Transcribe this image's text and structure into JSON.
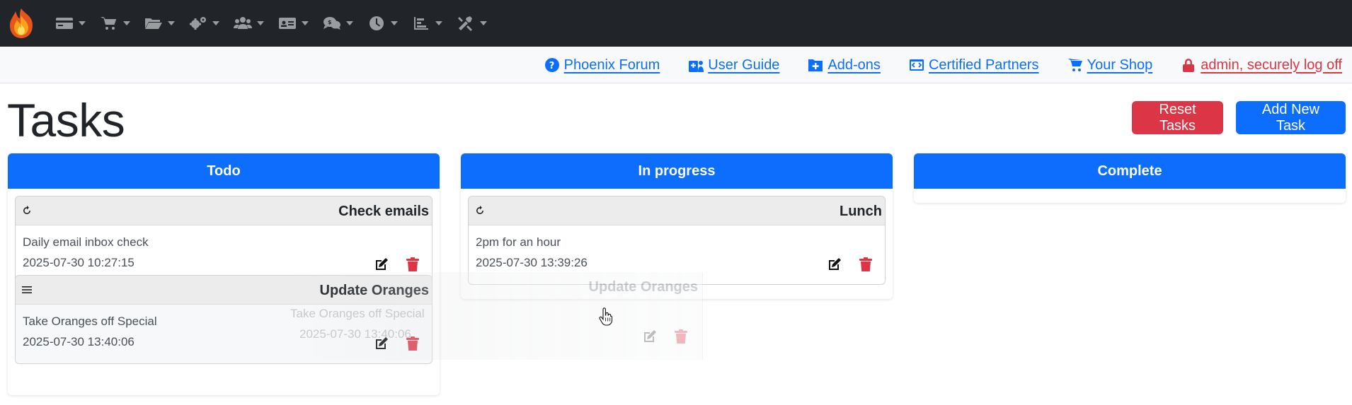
{
  "nav": {
    "icons": [
      "credit-card-icon",
      "shopping-cart-icon",
      "folder-open-icon",
      "gears-icon",
      "users-icon",
      "id-card-icon",
      "comments-dollar-icon",
      "clock-icon",
      "bar-chart-icon",
      "tools-icon"
    ]
  },
  "links": {
    "forum": "Phoenix Forum",
    "guide": "User Guide",
    "addons": "Add-ons",
    "partners": "Certified Partners",
    "shop": "Your Shop",
    "logoff": "admin, securely log off"
  },
  "page": {
    "title": "Tasks",
    "reset_label": "Reset Tasks",
    "add_label": "Add New Task"
  },
  "columns": {
    "todo": {
      "title": "Todo",
      "tasks": [
        {
          "title": "Check emails",
          "description": "Daily email inbox check",
          "date": "2025-07-30 10:27:15",
          "icon": "recurring-icon"
        },
        {
          "title": "Update Oranges",
          "description": "Take Oranges off Special",
          "date": "2025-07-30 13:40:06",
          "icon": "drag-handle-icon"
        }
      ]
    },
    "progress": {
      "title": "In progress",
      "tasks": [
        {
          "title": "Lunch",
          "description": "2pm for an hour",
          "date": "2025-07-30 13:39:26",
          "icon": "recurring-icon"
        }
      ]
    },
    "complete": {
      "title": "Complete",
      "tasks": []
    }
  },
  "ghost": {
    "title": "Update Oranges",
    "description": "Take Oranges off Special",
    "date": "2025-07-30 13:40:06"
  },
  "colors": {
    "primary": "#0d6efd",
    "danger": "#dc3545",
    "navbar": "#212529",
    "linkbar": "#f8f9fa"
  }
}
